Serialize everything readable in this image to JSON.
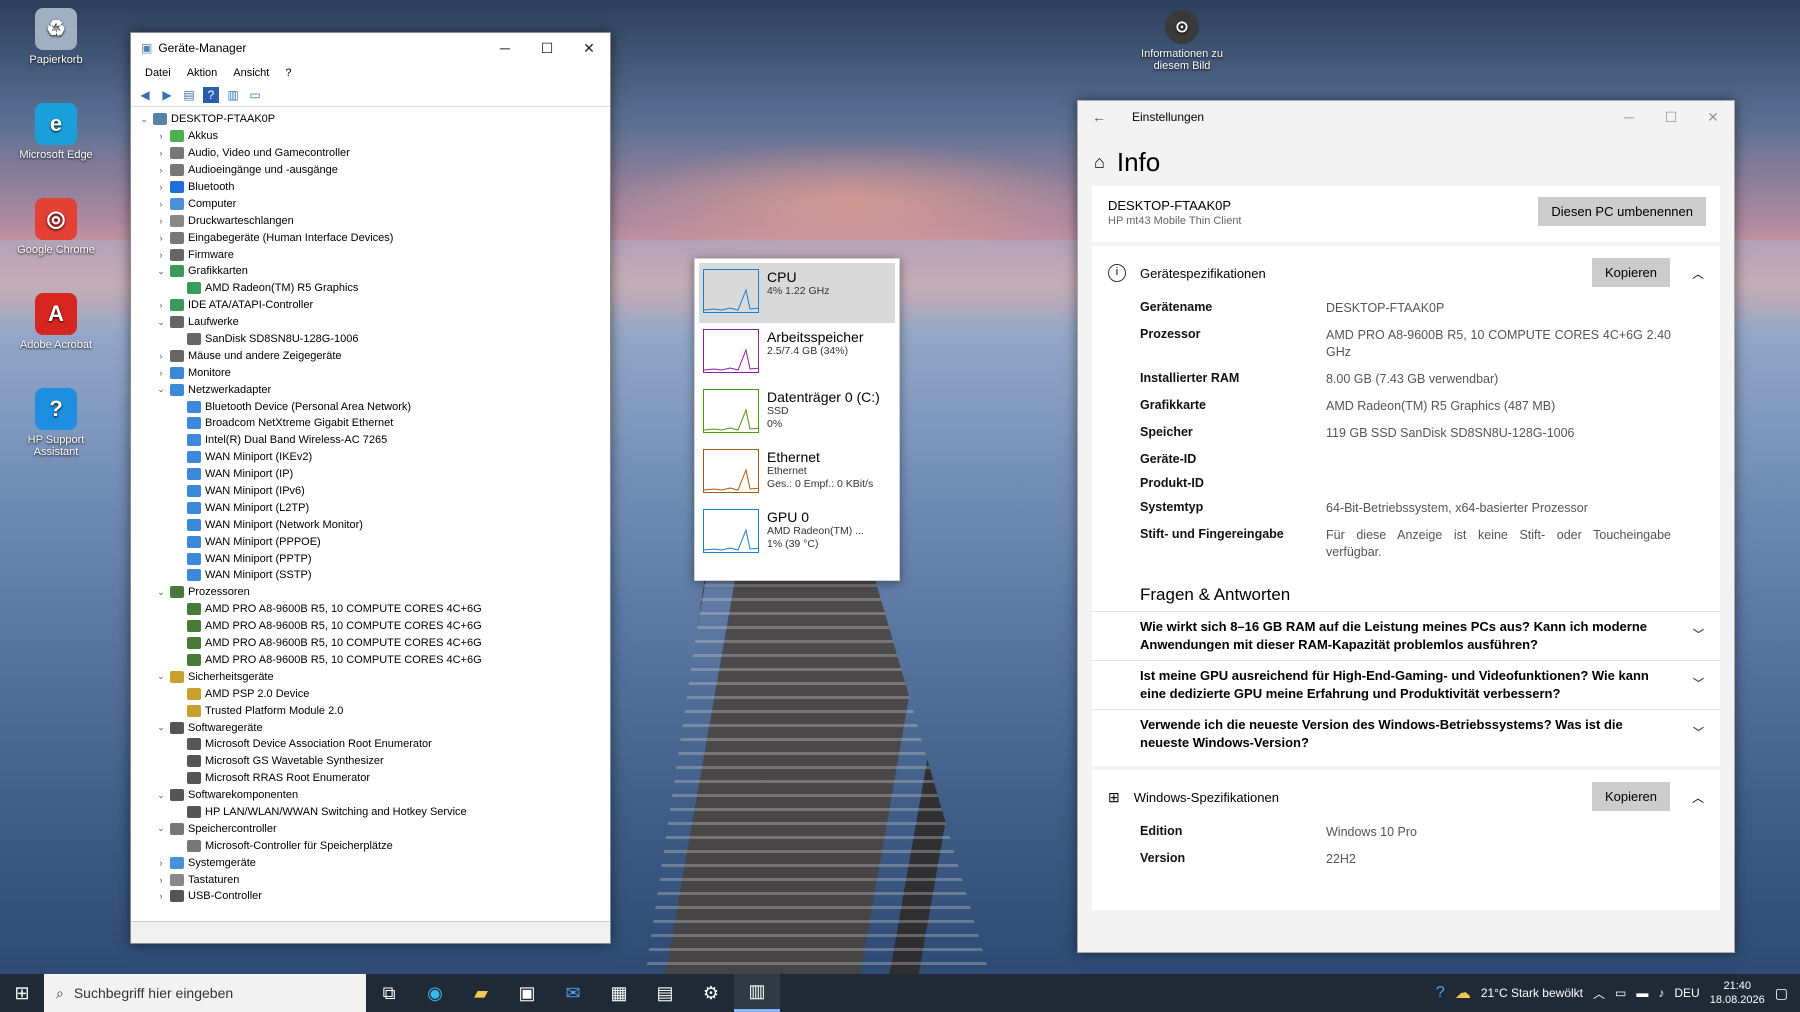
{
  "desktop": {
    "icons": [
      {
        "label": "Papierkorb",
        "icon": "recycle-bin-icon",
        "color": "#9fb0c0"
      },
      {
        "label": "Microsoft Edge",
        "icon": "edge-icon",
        "color": "#1aa0d8"
      },
      {
        "label": "Google Chrome",
        "icon": "chrome-icon",
        "color": "#e34133"
      },
      {
        "label": "Adobe Acrobat",
        "icon": "acrobat-icon",
        "color": "#d7261f"
      },
      {
        "label": "HP Support Assistant",
        "icon": "hp-support-icon",
        "color": "#1e8fe0"
      }
    ],
    "photo_info": "Informationen zu diesem Bild"
  },
  "device_manager": {
    "title": "Geräte-Manager",
    "menu": [
      "Datei",
      "Aktion",
      "Ansicht",
      "?"
    ],
    "tree": [
      {
        "level": 0,
        "exp": "v",
        "label": "DESKTOP-FTAAK0P",
        "color": "#5a7fa8"
      },
      {
        "level": 1,
        "exp": ">",
        "label": "Akkus",
        "color": "#4caf50"
      },
      {
        "level": 1,
        "exp": ">",
        "label": "Audio, Video und Gamecontroller",
        "color": "#777"
      },
      {
        "level": 1,
        "exp": ">",
        "label": "Audioeingänge und -ausgänge",
        "color": "#777"
      },
      {
        "level": 1,
        "exp": ">",
        "label": "Bluetooth",
        "color": "#1e6fd9"
      },
      {
        "level": 1,
        "exp": ">",
        "label": "Computer",
        "color": "#4a90d9"
      },
      {
        "level": 1,
        "exp": ">",
        "label": "Druckwarteschlangen",
        "color": "#888"
      },
      {
        "level": 1,
        "exp": ">",
        "label": "Eingabegeräte (Human Interface Devices)",
        "color": "#777"
      },
      {
        "level": 1,
        "exp": ">",
        "label": "Firmware",
        "color": "#666"
      },
      {
        "level": 1,
        "exp": "v",
        "label": "Grafikkarten",
        "color": "#3a9a5a"
      },
      {
        "level": 2,
        "exp": "",
        "label": "AMD Radeon(TM) R5 Graphics",
        "color": "#3a9a5a"
      },
      {
        "level": 1,
        "exp": ">",
        "label": "IDE ATA/ATAPI-Controller",
        "color": "#3a9a5a"
      },
      {
        "level": 1,
        "exp": "v",
        "label": "Laufwerke",
        "color": "#666"
      },
      {
        "level": 2,
        "exp": "",
        "label": "SanDisk SD8SN8U-128G-1006",
        "color": "#666"
      },
      {
        "level": 1,
        "exp": ">",
        "label": "Mäuse und andere Zeigegeräte",
        "color": "#666"
      },
      {
        "level": 1,
        "exp": ">",
        "label": "Monitore",
        "color": "#3a8ad9"
      },
      {
        "level": 1,
        "exp": "v",
        "label": "Netzwerkadapter",
        "color": "#3a8ad9"
      },
      {
        "level": 2,
        "exp": "",
        "label": "Bluetooth Device (Personal Area Network)",
        "color": "#3a8ad9"
      },
      {
        "level": 2,
        "exp": "",
        "label": "Broadcom NetXtreme Gigabit Ethernet",
        "color": "#3a8ad9"
      },
      {
        "level": 2,
        "exp": "",
        "label": "Intel(R) Dual Band Wireless-AC 7265",
        "color": "#3a8ad9"
      },
      {
        "level": 2,
        "exp": "",
        "label": "WAN Miniport (IKEv2)",
        "color": "#3a8ad9"
      },
      {
        "level": 2,
        "exp": "",
        "label": "WAN Miniport (IP)",
        "color": "#3a8ad9"
      },
      {
        "level": 2,
        "exp": "",
        "label": "WAN Miniport (IPv6)",
        "color": "#3a8ad9"
      },
      {
        "level": 2,
        "exp": "",
        "label": "WAN Miniport (L2TP)",
        "color": "#3a8ad9"
      },
      {
        "level": 2,
        "exp": "",
        "label": "WAN Miniport (Network Monitor)",
        "color": "#3a8ad9"
      },
      {
        "level": 2,
        "exp": "",
        "label": "WAN Miniport (PPPOE)",
        "color": "#3a8ad9"
      },
      {
        "level": 2,
        "exp": "",
        "label": "WAN Miniport (PPTP)",
        "color": "#3a8ad9"
      },
      {
        "level": 2,
        "exp": "",
        "label": "WAN Miniport (SSTP)",
        "color": "#3a8ad9"
      },
      {
        "level": 1,
        "exp": "v",
        "label": "Prozessoren",
        "color": "#4a7a3a"
      },
      {
        "level": 2,
        "exp": "",
        "label": "AMD PRO A8-9600B R5, 10 COMPUTE CORES 4C+6G",
        "color": "#4a7a3a"
      },
      {
        "level": 2,
        "exp": "",
        "label": "AMD PRO A8-9600B R5, 10 COMPUTE CORES 4C+6G",
        "color": "#4a7a3a"
      },
      {
        "level": 2,
        "exp": "",
        "label": "AMD PRO A8-9600B R5, 10 COMPUTE CORES 4C+6G",
        "color": "#4a7a3a"
      },
      {
        "level": 2,
        "exp": "",
        "label": "AMD PRO A8-9600B R5, 10 COMPUTE CORES 4C+6G",
        "color": "#4a7a3a"
      },
      {
        "level": 1,
        "exp": "v",
        "label": "Sicherheitsgeräte",
        "color": "#c8a030"
      },
      {
        "level": 2,
        "exp": "",
        "label": "AMD PSP 2.0 Device",
        "color": "#c8a030"
      },
      {
        "level": 2,
        "exp": "",
        "label": "Trusted Platform Module 2.0",
        "color": "#c8a030"
      },
      {
        "level": 1,
        "exp": "v",
        "label": "Softwaregeräte",
        "color": "#555"
      },
      {
        "level": 2,
        "exp": "",
        "label": "Microsoft Device Association Root Enumerator",
        "color": "#555"
      },
      {
        "level": 2,
        "exp": "",
        "label": "Microsoft GS Wavetable Synthesizer",
        "color": "#555"
      },
      {
        "level": 2,
        "exp": "",
        "label": "Microsoft RRAS Root Enumerator",
        "color": "#555"
      },
      {
        "level": 1,
        "exp": "v",
        "label": "Softwarekomponenten",
        "color": "#555"
      },
      {
        "level": 2,
        "exp": "",
        "label": "HP LAN/WLAN/WWAN Switching and Hotkey Service",
        "color": "#555"
      },
      {
        "level": 1,
        "exp": "v",
        "label": "Speichercontroller",
        "color": "#777"
      },
      {
        "level": 2,
        "exp": "",
        "label": "Microsoft-Controller für Speicherplätze",
        "color": "#777"
      },
      {
        "level": 1,
        "exp": ">",
        "label": "Systemgeräte",
        "color": "#4a90d9"
      },
      {
        "level": 1,
        "exp": ">",
        "label": "Tastaturen",
        "color": "#888"
      },
      {
        "level": 1,
        "exp": ">",
        "label": "USB-Controller",
        "color": "#555"
      }
    ]
  },
  "perf": {
    "items": [
      {
        "title": "CPU",
        "sub1": "4% 1.22 GHz",
        "sub2": "",
        "sub3": "",
        "color": "#1b7fcf"
      },
      {
        "title": "Arbeitsspeicher",
        "sub1": "2.5/7.4 GB (34%)",
        "sub2": "",
        "sub3": "",
        "color": "#8b1fa8"
      },
      {
        "title": "Datenträger 0 (C:)",
        "sub1": "SSD",
        "sub2": "0%",
        "sub3": "",
        "color": "#4e9a06"
      },
      {
        "title": "Ethernet",
        "sub1": "Ethernet",
        "sub2": "Ges.: 0 Empf.: 0 KBit/s",
        "sub3": "",
        "color": "#a75a13"
      },
      {
        "title": "GPU 0",
        "sub1": "AMD Radeon(TM) ...",
        "sub2": "1% (39 °C)",
        "sub3": "",
        "color": "#1b7fcf"
      }
    ]
  },
  "settings": {
    "window_title": "Einstellungen",
    "page_title": "Info",
    "pc_name": "DESKTOP-FTAAK0P",
    "pc_model": "HP mt43 Mobile Thin Client",
    "rename_button": "Diesen PC umbenennen",
    "device_specs_title": "Gerätespezifikationen",
    "copy_label": "Kopieren",
    "device_specs": [
      {
        "k": "Gerätename",
        "v": "DESKTOP-FTAAK0P"
      },
      {
        "k": "Prozessor",
        "v": "AMD PRO A8-9600B R5, 10 COMPUTE CORES 4C+6G 2.40 GHz"
      },
      {
        "k": "Installierter RAM",
        "v": "8.00 GB (7.43 GB verwendbar)"
      },
      {
        "k": "Grafikkarte",
        "v": "AMD Radeon(TM) R5 Graphics (487 MB)"
      },
      {
        "k": "Speicher",
        "v": "119 GB SSD SanDisk SD8SN8U-128G-1006"
      },
      {
        "k": "Geräte-ID",
        "v": ""
      },
      {
        "k": "Produkt-ID",
        "v": ""
      },
      {
        "k": "Systemtyp",
        "v": "64-Bit-Betriebssystem, x64-basierter Prozessor"
      },
      {
        "k": "Stift- und Fingereingabe",
        "v": "Für diese Anzeige ist keine Stift- oder Toucheingabe verfügbar."
      }
    ],
    "faq_title": "Fragen & Antworten",
    "faq": [
      "Wie wirkt sich 8–16 GB RAM auf die Leistung meines PCs aus? Kann ich moderne Anwendungen mit dieser RAM-Kapazität problemlos ausführen?",
      "Ist meine GPU ausreichend für High-End-Gaming- und Videofunktionen? Wie kann eine dedizierte GPU meine Erfahrung und Produktivität verbessern?",
      "Verwende ich die neueste Version des Windows-Betriebssystems? Was ist die neueste Windows-Version?"
    ],
    "windows_specs_title": "Windows-Spezifikationen",
    "windows_specs": [
      {
        "k": "Edition",
        "v": "Windows 10 Pro"
      },
      {
        "k": "Version",
        "v": "22H2"
      }
    ]
  },
  "taskbar": {
    "search_placeholder": "Suchbegriff hier eingeben",
    "weather": "21°C  Stark bewölkt",
    "lang": "DEU",
    "time": "21:40",
    "date": "18.08.2026"
  }
}
